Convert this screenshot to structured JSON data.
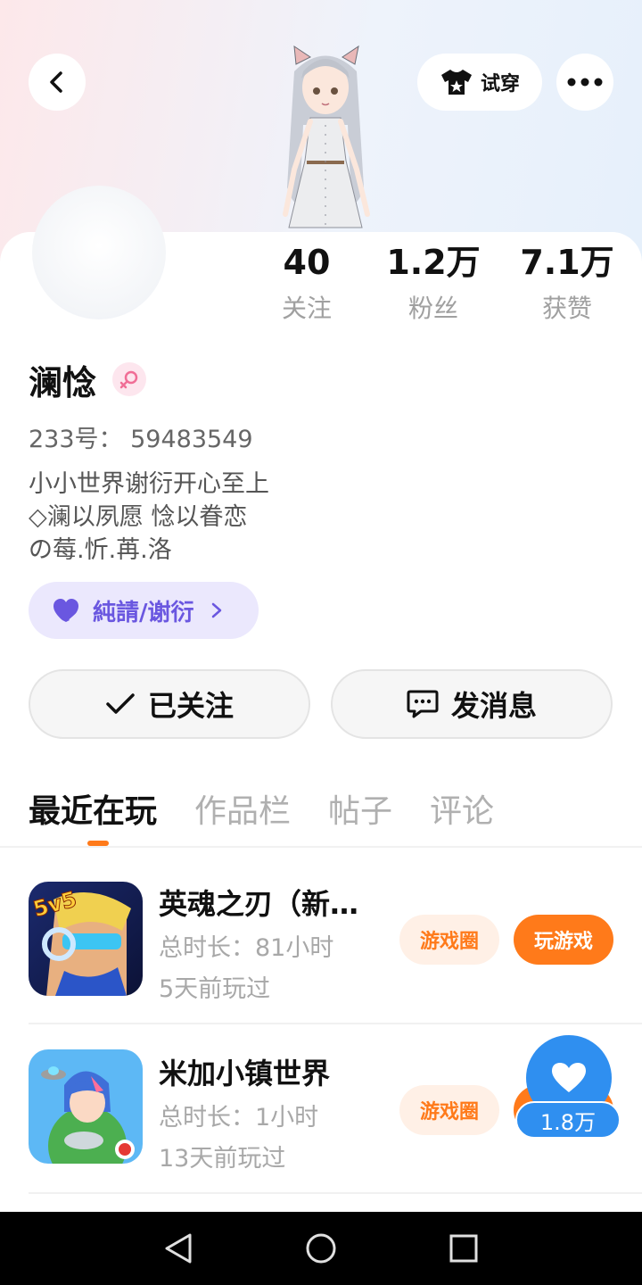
{
  "header": {
    "tryon_label": "试穿"
  },
  "profile": {
    "name": "澜惗",
    "uid_text": "233号： 59483549",
    "bio_lines": [
      "小小世界谢衍开心至上",
      "◇澜以夙愿 惗以眷恋",
      "の莓.忻.苒.洛"
    ],
    "tag_label": "純請/谢衍"
  },
  "stats": [
    {
      "value": "40",
      "label": "关注"
    },
    {
      "value": "1.2万",
      "label": "粉丝"
    },
    {
      "value": "7.1万",
      "label": "获赞"
    }
  ],
  "actions": {
    "follow_label": "已关注",
    "message_label": "发消息"
  },
  "tabs": [
    {
      "label": "最近在玩",
      "active": true
    },
    {
      "label": "作品栏",
      "active": false
    },
    {
      "label": "帖子",
      "active": false
    },
    {
      "label": "评论",
      "active": false
    }
  ],
  "games": [
    {
      "title": "英魂之刃（新…",
      "duration": "总时长：81小时",
      "last_played": "5天前玩过",
      "circle_label": "游戏圈",
      "play_label": "玩游戏",
      "icon_badge": "5v5"
    },
    {
      "title": "米加小镇世界",
      "duration": "总时长：1小时",
      "last_played": "13天前玩过",
      "circle_label": "游戏圈"
    }
  ],
  "like_fab": {
    "count": "1.8万"
  },
  "colors": {
    "accent_orange": "#ff7a1a",
    "tag_purple": "#6a57e0",
    "fab_blue": "#2f8ff0"
  }
}
